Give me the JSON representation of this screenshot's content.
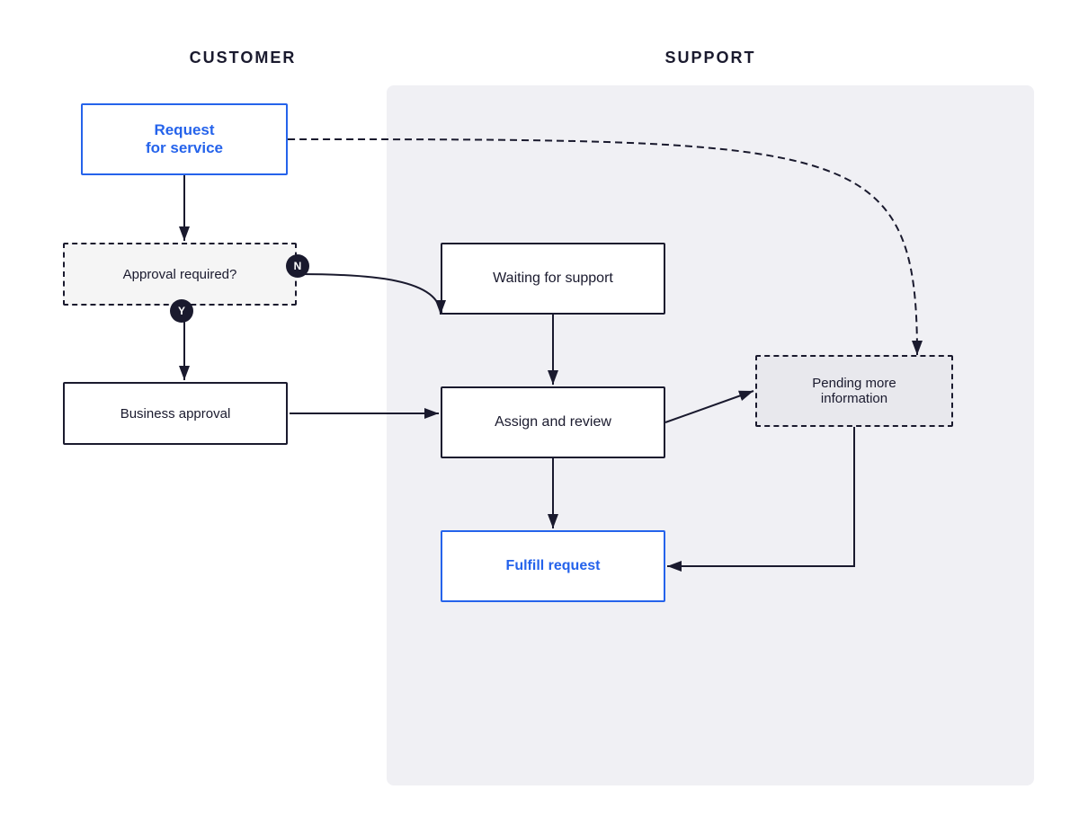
{
  "header": {
    "customer_label": "CUSTOMER",
    "support_label": "SUPPORT"
  },
  "boxes": {
    "request_service": "Request\nfor service",
    "approval_required": "Approval required?",
    "business_approval": "Business approval",
    "waiting_for_support": "Waiting for support",
    "assign_and_review": "Assign and review",
    "fulfill_request": "Fulfill request",
    "pending_more_info": "Pending more\ninformation"
  },
  "badges": {
    "n": "N",
    "y": "Y"
  },
  "colors": {
    "blue": "#2563eb",
    "dark": "#1a1a2e",
    "bg_support": "#ebebf0",
    "bg_white": "#ffffff"
  }
}
